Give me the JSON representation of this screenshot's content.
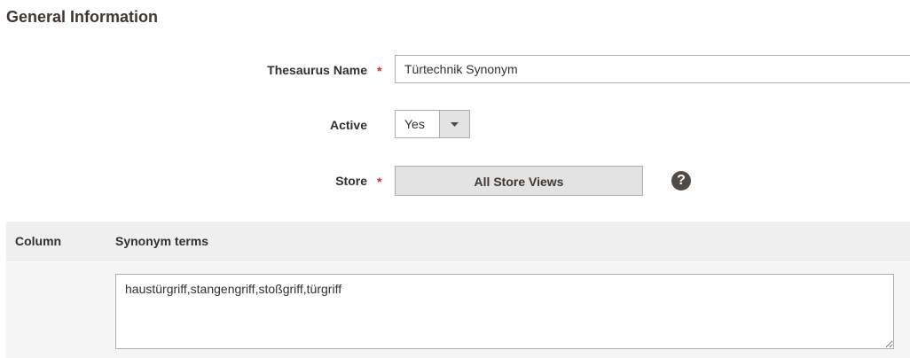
{
  "section": {
    "title": "General Information"
  },
  "fields": {
    "thesaurus_name": {
      "label": "Thesaurus Name",
      "required_mark": "*",
      "value": "Türtechnik Synonym"
    },
    "active": {
      "label": "Active",
      "value": "Yes",
      "options": [
        "Yes"
      ]
    },
    "store": {
      "label": "Store",
      "required_mark": "*",
      "button_label": "All Store Views",
      "help_glyph": "?"
    }
  },
  "grid": {
    "columns": [
      "Column",
      "Synonym terms"
    ],
    "rows": [
      {
        "synonym_terms": "haustürgriff,stangengriff,stoßgriff,türgriff"
      }
    ]
  },
  "colors": {
    "required": "#e22626",
    "header_bg": "#efefef",
    "body_bg": "#f5f5f5",
    "help_icon_bg": "#514943"
  }
}
